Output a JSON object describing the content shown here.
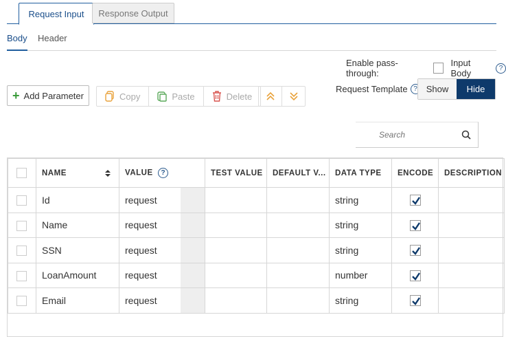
{
  "tabs": [
    {
      "label": "Request Input",
      "active": true
    },
    {
      "label": "Response Output",
      "active": false
    }
  ],
  "subtabs": [
    {
      "label": "Body",
      "active": true
    },
    {
      "label": "Header",
      "active": false
    }
  ],
  "passthrough": {
    "label": "Enable pass-through:",
    "option_label": "Input Body",
    "checked": false
  },
  "toolbar": {
    "add_label": "Add Parameter",
    "copy_label": "Copy",
    "paste_label": "Paste",
    "delete_label": "Delete"
  },
  "template": {
    "label": "Request Template",
    "show_label": "Show",
    "hide_label": "Hide",
    "selected": "Hide"
  },
  "search": {
    "placeholder": "Search"
  },
  "table": {
    "headers": [
      "NAME",
      "VALUE",
      "TEST VALUE",
      "DEFAULT V...",
      "DATA TYPE",
      "ENCODE",
      "DESCRIPTION"
    ],
    "rows": [
      {
        "name": "Id",
        "value": "request",
        "test_value": "",
        "default_value": "",
        "data_type": "string",
        "encode": true,
        "description": ""
      },
      {
        "name": "Name",
        "value": "request",
        "test_value": "",
        "default_value": "",
        "data_type": "string",
        "encode": true,
        "description": ""
      },
      {
        "name": "SSN",
        "value": "request",
        "test_value": "",
        "default_value": "",
        "data_type": "string",
        "encode": true,
        "description": ""
      },
      {
        "name": "LoanAmount",
        "value": "request",
        "test_value": "",
        "default_value": "",
        "data_type": "number",
        "encode": true,
        "description": ""
      },
      {
        "name": "Email",
        "value": "request",
        "test_value": "",
        "default_value": "",
        "data_type": "string",
        "encode": true,
        "description": ""
      }
    ]
  },
  "colors": {
    "accent": "#1f5d9e",
    "toggle_active": "#0e3a6b",
    "add_icon": "#3a9b3a",
    "arrow_icon": "#e9a23b"
  }
}
